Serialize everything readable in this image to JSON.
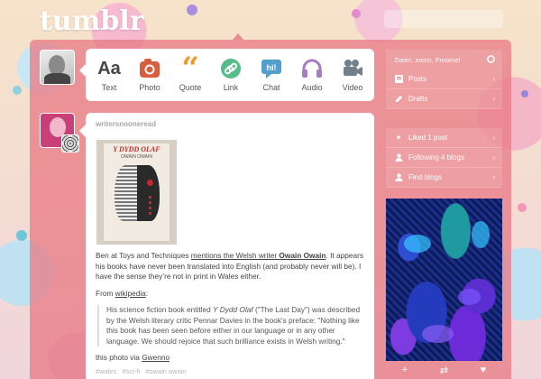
{
  "app": {
    "logo": "tumblr"
  },
  "composer": {
    "items": [
      {
        "label": "Text",
        "icon": "text-icon",
        "color": "#444444"
      },
      {
        "label": "Photo",
        "icon": "camera-icon",
        "color": "#d95e40"
      },
      {
        "label": "Quote",
        "icon": "quote-icon",
        "color": "#f2992e"
      },
      {
        "label": "Link",
        "icon": "link-icon",
        "color": "#56bc8a"
      },
      {
        "label": "Chat",
        "icon": "chat-icon",
        "color": "#529ecc"
      },
      {
        "label": "Audio",
        "icon": "headphones-icon",
        "color": "#a77dc2"
      },
      {
        "label": "Video",
        "icon": "video-camera-icon",
        "color": "#748089"
      }
    ]
  },
  "post": {
    "blog_name": "writersnooneread",
    "cover_title": "Y DYDD OLAF",
    "cover_author": "OWAIN OWAIN",
    "para1_a": "Ben at Toys and Techniques ",
    "para1_link1": "mentions the Welsh writer ",
    "para1_link2": "Owain Owain",
    "para1_b": ". It appears his books have never been translated into English (and probably never will be). I have the sense they’re not in print in Wales either.",
    "para2_a": "From ",
    "para2_link": "wikipedia",
    "para2_b": ":",
    "quote_a": "His science fiction book entitled ",
    "quote_title": "Y Dydd Olaf",
    "quote_b": " (\"The Last Day\") was described by the Welsh literary critic Pennar Davies in the book's preface: \"Nothing like this book has been seen before either in our language or in any other language. We should rejoice that such brilliance exists in Welsh writing.\"",
    "para3_a": "this photo via ",
    "para3_link": "Gwenno",
    "tags": [
      "#wales",
      "#sci-fi",
      "#owain owain"
    ]
  },
  "sidebar": {
    "blog_title": "Zoom, zoom, Froome!",
    "blog_items": [
      {
        "label": "Posts",
        "icon": "posts-icon"
      },
      {
        "label": "Drafts",
        "icon": "drafts-icon"
      }
    ],
    "account_items": [
      {
        "label": "Liked 1 post",
        "icon": "heart-icon"
      },
      {
        "label": "Following 4 blogs",
        "icon": "person-icon"
      },
      {
        "label": "Find blogs",
        "icon": "person-icon"
      }
    ]
  },
  "colors": {
    "accent": "#e87c86",
    "card": "#ffffff"
  }
}
